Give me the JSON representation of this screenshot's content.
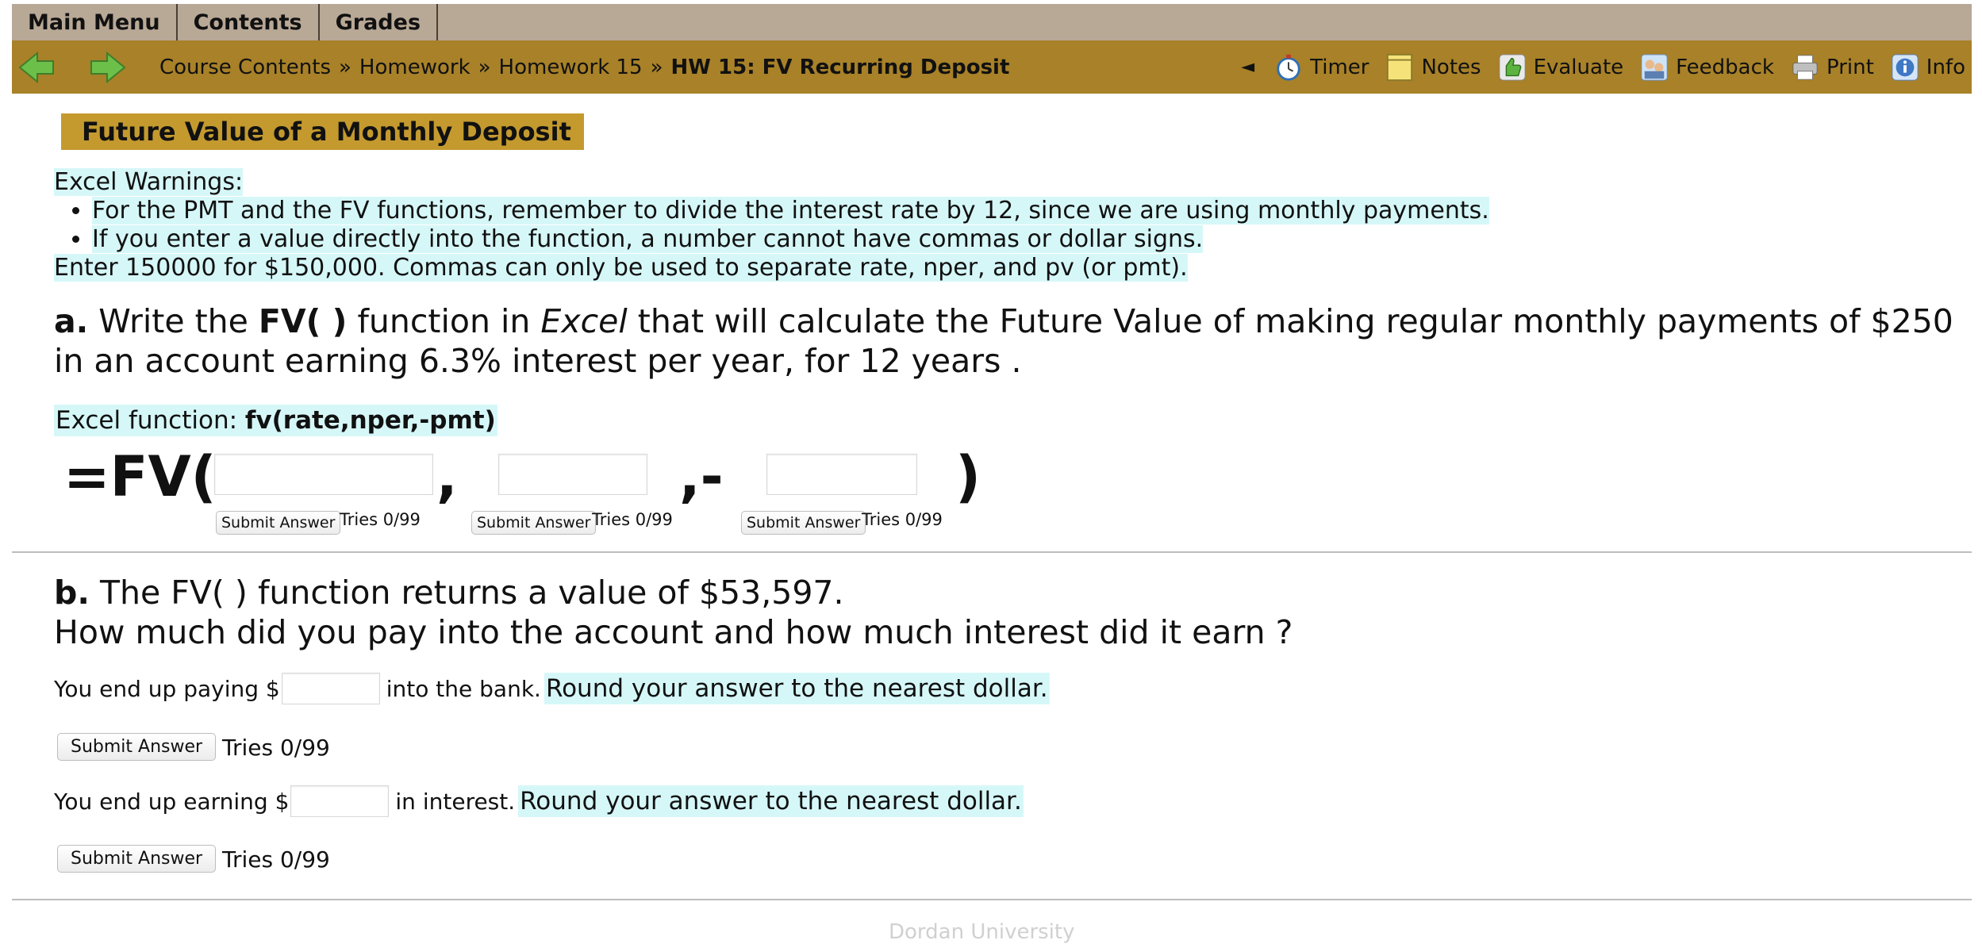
{
  "menu": {
    "items": [
      "Main Menu",
      "Contents",
      "Grades"
    ]
  },
  "breadcrumb": {
    "items": [
      "Course Contents",
      "Homework",
      "Homework 15"
    ],
    "separator": "»",
    "current": "HW 15: FV Recurring Deposit"
  },
  "tools": {
    "collapse": "◄",
    "timer": "Timer",
    "notes": "Notes",
    "evaluate": "Evaluate",
    "feedback": "Feedback",
    "print": "Print",
    "info": "Info"
  },
  "title": "Future Value of a Monthly Deposit",
  "warnings": {
    "heading": "Excel Warnings:",
    "bullets": [
      "For the PMT and the FV functions, remember to divide the interest rate by 12, since we are using monthly payments.",
      "If you enter a value directly into the function, a number cannot have commas or dollar signs."
    ],
    "note": "Enter 150000 for $150,000. Commas can only be used to separate rate, nper, and pv (or pmt)."
  },
  "part_a": {
    "label": "a.",
    "text1": "Write the",
    "bold": "FV( )",
    "text2": "function in",
    "italic": "Excel",
    "text3": "that will calculate the Future Value of making regular monthly payments of $250 in an account earning 6.3% interest per year, for 12 years .",
    "excel_label": "Excel function:",
    "excel_formula": "fv(rate,nper,-pmt)",
    "fv_open": "=FV(",
    "comma1": ",",
    "comma2": ",-",
    "fv_close": ")",
    "inputs": [
      "",
      "",
      ""
    ],
    "submit": "Submit Answer",
    "tries": "Tries 0/99"
  },
  "part_b": {
    "label": "b.",
    "line1": "The FV( ) function returns a value of $53,597.",
    "line2": "How much did you pay into the account and how much interest did it earn ?",
    "q1_before": "You end up paying $",
    "q1_after": "into the bank.",
    "q2_before": "You end up earning $",
    "q2_after": "in interest.",
    "round_note": "Round your answer to the nearest dollar.",
    "inputs": [
      "",
      ""
    ],
    "submit": "Submit Answer",
    "tries": "Tries 0/99"
  },
  "footer": "Dordan University",
  "colors": {
    "nav": "#a88128",
    "menu": "#b8a896",
    "title": "#c49a2e",
    "highlight": "#d6f7f8"
  }
}
